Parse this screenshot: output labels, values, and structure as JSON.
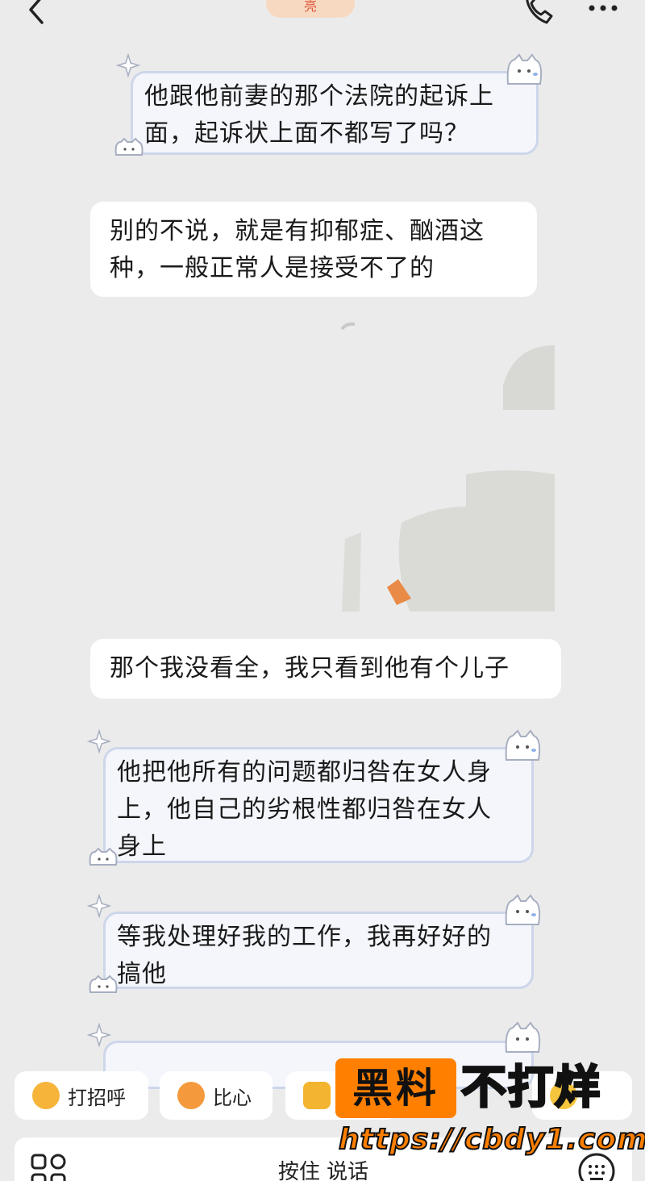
{
  "header": {
    "title_partial": "亮",
    "accent": "#e2593b"
  },
  "messages": [
    {
      "id": "m1",
      "style": "cute",
      "text_lines": [
        "他跟他前妻的那个法院的起诉上",
        "面，起诉状上面不都写了吗？"
      ]
    },
    {
      "id": "m2",
      "style": "plain",
      "text_lines": [
        "别的不说，就是有抑郁症、酗酒这",
        "种，一般正常人是接受不了的"
      ]
    },
    {
      "id": "m3",
      "style": "image",
      "alt": "blurred-photo"
    },
    {
      "id": "m4",
      "style": "plain",
      "text_lines": [
        "那个我没看全，我只看到他有个儿子"
      ]
    },
    {
      "id": "m5",
      "style": "cute",
      "text_lines": [
        "他把他所有的问题都归咎在女人身",
        "上，他自己的劣根性都归咎在女人",
        "身上"
      ]
    },
    {
      "id": "m6",
      "style": "cute",
      "text_lines": [
        "等我处理好我的工作，我再好好的",
        "搞他"
      ]
    }
  ],
  "quick_replies": [
    {
      "label": "打招呼",
      "icon": "wave-emoji-icon"
    },
    {
      "label": "比心",
      "icon": "heart-hands-emoji-icon"
    },
    {
      "label": "",
      "icon": "thumbs-up-emoji-icon"
    },
    {
      "label": "",
      "icon": "smile-emoji-icon"
    }
  ],
  "input_bar": {
    "hold_to_talk": "按住 说话"
  },
  "watermark": {
    "box_text": "黑料",
    "text": "不打烊",
    "url": "https://cbdy1.com",
    "color": "#ff7f00"
  }
}
